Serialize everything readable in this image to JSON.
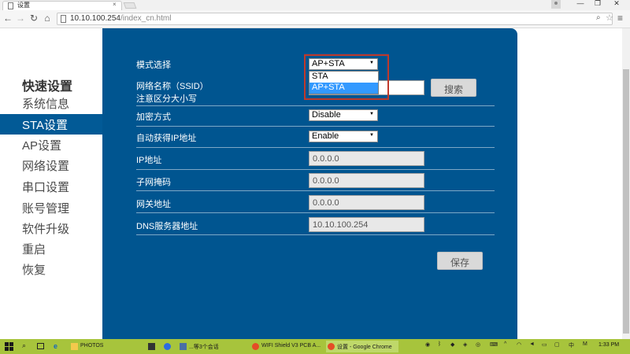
{
  "browser": {
    "tab_title": "设置",
    "tab_close": "×",
    "url_host": "10.10.100.254",
    "url_path": "/index_cn.html",
    "window_buttons": {
      "minimize": "—",
      "restore": "❐",
      "close": "✕"
    },
    "nav": {
      "back": "←",
      "forward": "→",
      "reload": "↻",
      "home": "⌂"
    },
    "zoom_glyph": "⌕",
    "star_glyph": "☆",
    "menu_glyph": "≡"
  },
  "sidebar": {
    "header": "快速设置",
    "items": [
      {
        "label": "系统信息",
        "active": false
      },
      {
        "label": "STA设置",
        "active": true
      },
      {
        "label": "AP设置",
        "active": false
      },
      {
        "label": "网络设置",
        "active": false
      },
      {
        "label": "串口设置",
        "active": false
      },
      {
        "label": "账号管理",
        "active": false
      },
      {
        "label": "软件升级",
        "active": false
      },
      {
        "label": "重启",
        "active": false
      },
      {
        "label": "恢复",
        "active": false
      }
    ]
  },
  "form": {
    "mode_label": "模式选择",
    "mode_value": "AP+STA",
    "mode_options": [
      "STA",
      "AP+STA"
    ],
    "mode_selected_option": "AP+STA",
    "ssid_label_line1": "网络名称（SSID）",
    "ssid_label_line2": "注意区分大小写",
    "search_button": "搜索",
    "encryption_label": "加密方式",
    "encryption_value": "Disable",
    "dhcp_label": "自动获得IP地址",
    "dhcp_value": "Enable",
    "ip_label": "IP地址",
    "ip_value": "0.0.0.0",
    "mask_label": "子网掩码",
    "mask_value": "0.0.0.0",
    "gateway_label": "网关地址",
    "gateway_value": "0.0.0.0",
    "dns_label": "DNS服务器地址",
    "dns_value": "10.10.100.254",
    "save_button": "保存",
    "caret_glyph": "▼"
  },
  "taskbar": {
    "items": [
      {
        "label": "PHOTOS",
        "active": false
      },
      {
        "label": "...等3个会话",
        "active": false
      },
      {
        "label": "WIFI Shield V3 PCB A...",
        "active": false
      },
      {
        "label": "设置 - Google Chrome",
        "active": true
      }
    ],
    "clock": "1:33 PM",
    "colors": {
      "bar": "#a7c43c",
      "active": "#bfd86a"
    }
  },
  "colors": {
    "panel": "#005590",
    "sidebar_active": "#025a96",
    "selected_option": "#3399ff",
    "highlight_border": "#c0392b"
  }
}
